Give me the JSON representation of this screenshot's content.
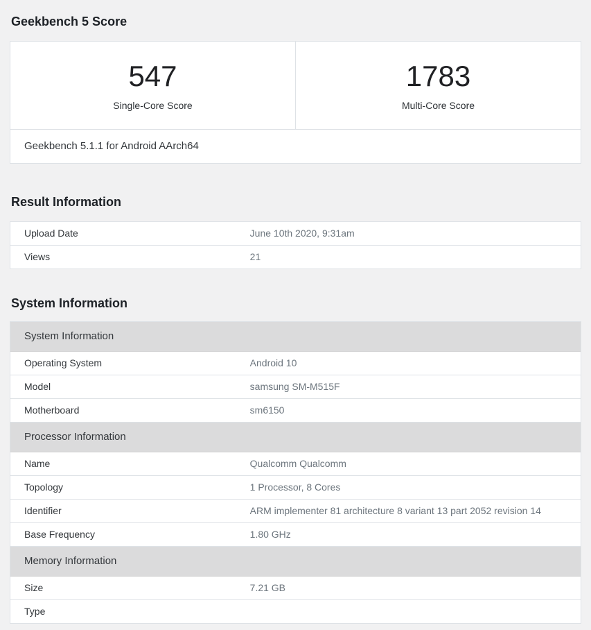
{
  "theme": {
    "page_bg": "#f1f1f2",
    "card_border": "#dee2e6",
    "group_header_bg": "#dbdbdc",
    "value_text": "#6c757d"
  },
  "score_section": {
    "title": "Geekbench 5 Score",
    "scores": [
      {
        "value": "547",
        "label": "Single-Core Score"
      },
      {
        "value": "1783",
        "label": "Multi-Core Score"
      }
    ],
    "footer": "Geekbench 5.1.1 for Android AArch64"
  },
  "result_information": {
    "title": "Result Information",
    "rows": [
      {
        "label": "Upload Date",
        "value": "June 10th 2020, 9:31am"
      },
      {
        "label": "Views",
        "value": "21"
      }
    ]
  },
  "system_information": {
    "title": "System Information",
    "sections": [
      {
        "header": "System Information",
        "rows": [
          {
            "label": "Operating System",
            "value": "Android 10"
          },
          {
            "label": "Model",
            "value": "samsung SM-M515F"
          },
          {
            "label": "Motherboard",
            "value": "sm6150"
          }
        ]
      },
      {
        "header": "Processor Information",
        "rows": [
          {
            "label": "Name",
            "value": "Qualcomm Qualcomm"
          },
          {
            "label": "Topology",
            "value": "1 Processor, 8 Cores"
          },
          {
            "label": "Identifier",
            "value": "ARM implementer 81 architecture 8 variant 13 part 2052 revision 14"
          },
          {
            "label": "Base Frequency",
            "value": "1.80 GHz"
          }
        ]
      },
      {
        "header": "Memory Information",
        "rows": [
          {
            "label": "Size",
            "value": "7.21 GB"
          },
          {
            "label": "Type",
            "value": ""
          }
        ]
      }
    ]
  }
}
